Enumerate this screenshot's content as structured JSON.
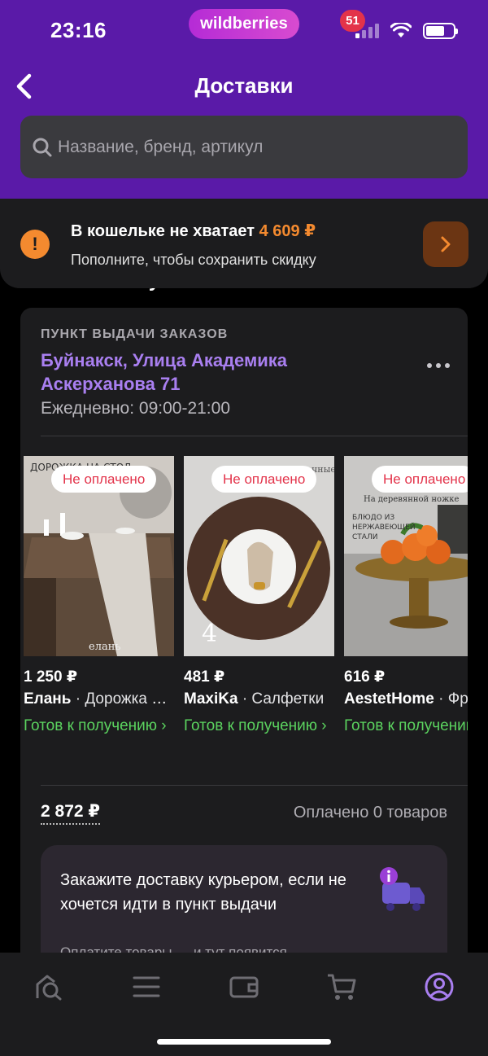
{
  "status_bar": {
    "time": "23:16",
    "brand": "wildberries"
  },
  "header": {
    "title": "Доставки"
  },
  "search": {
    "placeholder": "Название, бренд, артикул"
  },
  "wallet": {
    "title": "В кошельке не хватает",
    "amount": "4 609 ₽",
    "subtitle": "Пополните, чтобы сохранить скидку"
  },
  "section": {
    "heading": "Готово к получению"
  },
  "pickup": {
    "label": "ПУНКТ ВЫДАЧИ ЗАКАЗОВ",
    "address": "Буйнакск, Улица Академика Аскерханова 71",
    "hours": "Ежедневно: 09:00-21:00"
  },
  "products": [
    {
      "badge": "Не оплачено",
      "price": "1 250 ₽",
      "brand": "Елань",
      "title": "· Дорожка на стол",
      "status": "Готов к получению ›"
    },
    {
      "badge": "Не оплачено",
      "price": "481 ₽",
      "brand": "MaxiKa",
      "title": "· Салфетки",
      "status": "Готов к получению ›"
    },
    {
      "badge": "Не оплачено",
      "price": "616 ₽",
      "brand": "AestetHome",
      "title": "· Фруктовница",
      "status": "Готов к получению ›"
    }
  ],
  "summary": {
    "total": "2 872 ₽",
    "paid": "Оплачено 0 товаров"
  },
  "promo": {
    "text": "Закажите доставку курьером, если не хочется идти в пункт выдачи",
    "subtext": "Оплатите товары — и тут появится"
  },
  "tabbar": {
    "cart_count": "51",
    "items": [
      "home-icon",
      "catalog-icon",
      "wallet-icon",
      "cart-icon",
      "profile-icon"
    ]
  },
  "colors": {
    "header": "#5a1aa8",
    "accent": "#a97ff0",
    "warning": "#f48a2f",
    "ready": "#5bd35f",
    "danger": "#e3334a"
  }
}
